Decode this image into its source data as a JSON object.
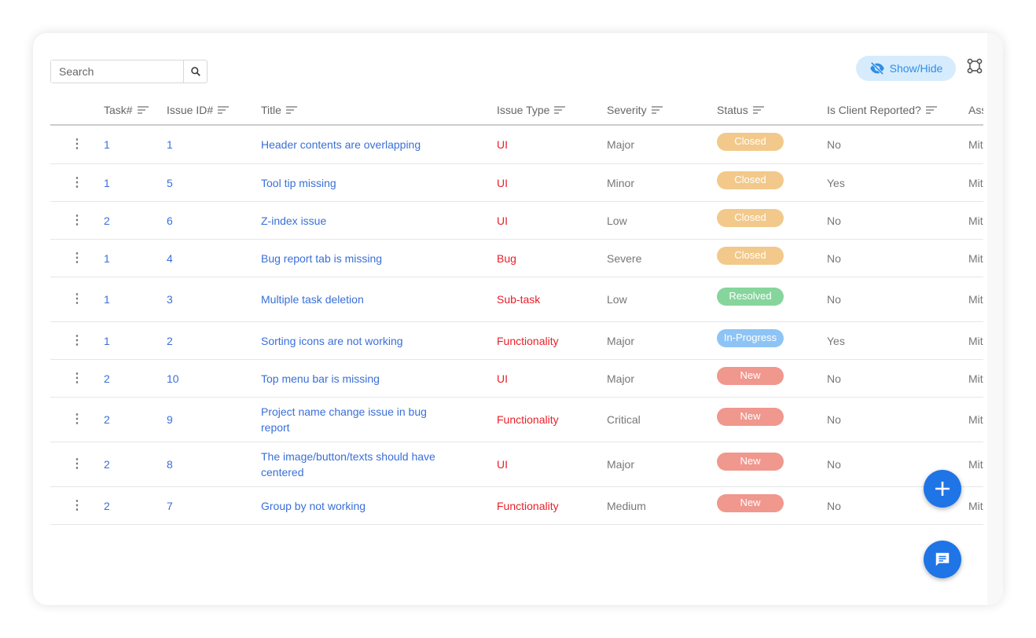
{
  "search": {
    "placeholder": "Search"
  },
  "toolbar": {
    "show_hide_label": "Show/Hide"
  },
  "colors": {
    "Closed": "#f2c98a",
    "Resolved": "#86d59c",
    "In-Progress": "#8ec4f5",
    "New": "#f0978e"
  },
  "columns": [
    "Task#",
    "Issue ID#",
    "Title",
    "Issue Type",
    "Severity",
    "Status",
    "Is Client Reported?",
    "Assignee"
  ],
  "rows": [
    {
      "task": "1",
      "id": "1",
      "title": "Header contents are overlapping",
      "type": "UI",
      "severity": "Major",
      "status": "Closed",
      "client": "No",
      "assignee": "Mit"
    },
    {
      "task": "1",
      "id": "5",
      "title": "Tool tip missing",
      "type": "UI",
      "severity": "Minor",
      "status": "Closed",
      "client": "Yes",
      "assignee": "Mit"
    },
    {
      "task": "2",
      "id": "6",
      "title": "Z-index issue",
      "type": "UI",
      "severity": "Low",
      "status": "Closed",
      "client": "No",
      "assignee": "Mit"
    },
    {
      "task": "1",
      "id": "4",
      "title": "Bug report tab is missing",
      "type": "Bug",
      "severity": "Severe",
      "status": "Closed",
      "client": "No",
      "assignee": "Mit"
    },
    {
      "task": "1",
      "id": "3",
      "title": "Multiple task deletion",
      "type": "Sub-task",
      "severity": "Low",
      "status": "Resolved",
      "client": "No",
      "assignee": "Mit"
    },
    {
      "task": "1",
      "id": "2",
      "title": "Sorting icons are not working",
      "type": "Functionality",
      "severity": "Major",
      "status": "In-Progress",
      "client": "Yes",
      "assignee": "Mit"
    },
    {
      "task": "2",
      "id": "10",
      "title": "Top menu bar is missing",
      "type": "UI",
      "severity": "Major",
      "status": "New",
      "client": "No",
      "assignee": "Mit"
    },
    {
      "task": "2",
      "id": "9",
      "title": "Project name change issue in bug report",
      "type": "Functionality",
      "severity": "Critical",
      "status": "New",
      "client": "No",
      "assignee": "Mit"
    },
    {
      "task": "2",
      "id": "8",
      "title": "The image/button/texts should have centered",
      "type": "UI",
      "severity": "Major",
      "status": "New",
      "client": "No",
      "assignee": "Mit"
    },
    {
      "task": "2",
      "id": "7",
      "title": "Group by not working",
      "type": "Functionality",
      "severity": "Medium",
      "status": "New",
      "client": "No",
      "assignee": "Mit"
    }
  ]
}
